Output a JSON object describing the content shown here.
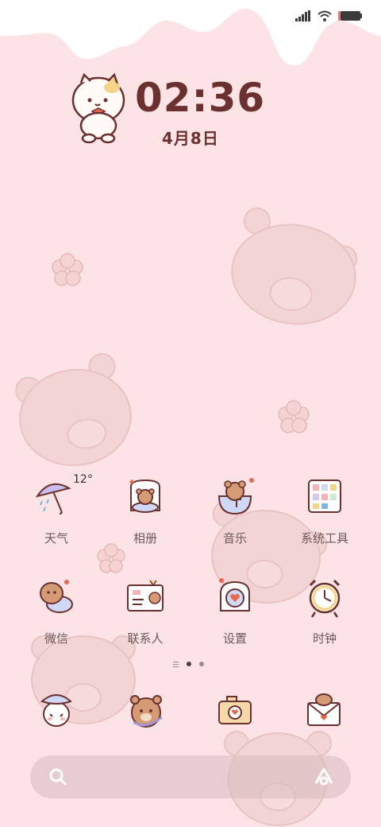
{
  "wallpaper": {
    "background_color": "#fce3e6",
    "drip_color": "#ffffff",
    "bear_color": "#f1cfcf"
  },
  "status_bar": {
    "icons": [
      "signal-icon",
      "wifi-icon",
      "battery-icon"
    ]
  },
  "clock_widget": {
    "time": "02:36",
    "date": "4月8日",
    "mascot": "cat-mascot-icon",
    "text_color": "#6b3130"
  },
  "apps": [
    {
      "label": "天气",
      "icon": "weather-umbrella-icon",
      "extra": "12°"
    },
    {
      "label": "相册",
      "icon": "gallery-bear-icon"
    },
    {
      "label": "音乐",
      "icon": "music-bear-icon"
    },
    {
      "label": "系统工具",
      "icon": "system-tools-icon"
    },
    {
      "label": "微信",
      "icon": "wechat-dog-icon"
    },
    {
      "label": "联系人",
      "icon": "contacts-bear-icon"
    },
    {
      "label": "设置",
      "icon": "settings-heart-icon"
    },
    {
      "label": "时钟",
      "icon": "alarm-clock-icon"
    }
  ],
  "page_indicator": {
    "pages": 2,
    "active": 0
  },
  "dock": [
    {
      "icon": "phone-cat-icon"
    },
    {
      "icon": "browser-bear-icon"
    },
    {
      "icon": "camera-icon"
    },
    {
      "icon": "messages-envelope-icon"
    }
  ],
  "search_bar": {
    "left_icon": "search-icon",
    "right_icon": "assistant-icon"
  }
}
